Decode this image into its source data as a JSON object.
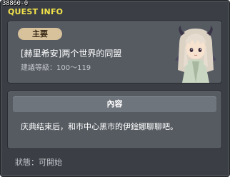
{
  "window": {
    "quest_id": "38860-0",
    "title": "QUEST INFO"
  },
  "quest": {
    "category": "主要",
    "name": "[赫里希安]两个世界的同盟",
    "level_requirement": "建議等級：100～119",
    "npc_icon": "npc-portrait"
  },
  "content": {
    "header": "內容",
    "text": "庆典结束后，和市中心黑市的伊鍂娜聊聊吧。"
  },
  "status": {
    "text": "狀態：可開始"
  },
  "colors": {
    "title": "#f2e24a",
    "tag_bg": "#d8c29c",
    "panel": "#565b62",
    "window": "#3b3f45"
  }
}
